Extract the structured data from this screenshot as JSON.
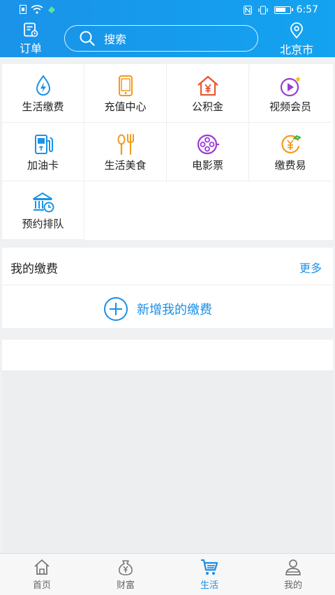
{
  "status": {
    "time": "6:57",
    "icons": [
      "nfc-icon",
      "vibrate-icon",
      "battery-icon"
    ]
  },
  "header": {
    "orders_label": "订单",
    "search_placeholder": "搜索",
    "city_label": "北京市"
  },
  "services": [
    {
      "label": "生活缴费",
      "icon": "water-bolt-icon"
    },
    {
      "label": "充值中心",
      "icon": "phone-recharge-icon"
    },
    {
      "label": "公积金",
      "icon": "housing-fund-icon"
    },
    {
      "label": "视频会员",
      "icon": "video-membership-icon"
    },
    {
      "label": "加油卡",
      "icon": "fuel-card-icon"
    },
    {
      "label": "生活美食",
      "icon": "food-icon"
    },
    {
      "label": "电影票",
      "icon": "movie-ticket-icon"
    },
    {
      "label": "缴费易",
      "icon": "easy-pay-icon"
    },
    {
      "label": "预约排队",
      "icon": "bank-queue-icon"
    }
  ],
  "my_payment": {
    "title": "我的缴费",
    "more": "更多",
    "add_label": "新增我的缴费"
  },
  "bottom_nav": [
    {
      "label": "首页",
      "icon": "home-icon"
    },
    {
      "label": "财富",
      "icon": "wealth-icon"
    },
    {
      "label": "生活",
      "icon": "cart-icon",
      "active": true
    },
    {
      "label": "我的",
      "icon": "profile-icon"
    }
  ],
  "colors": {
    "primary": "#1a93e8",
    "accent_text": "#1a8fe6"
  }
}
